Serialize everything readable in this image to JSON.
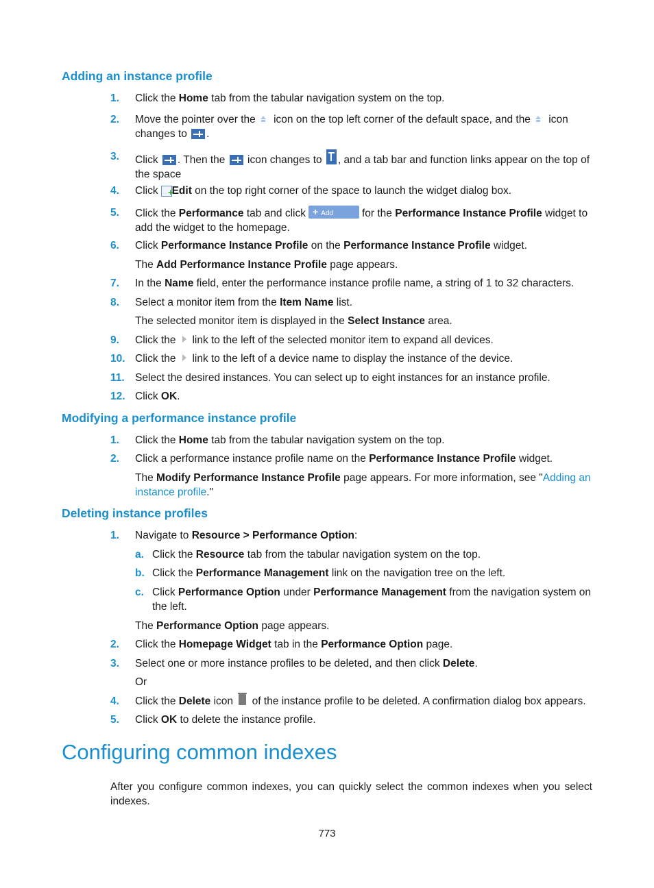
{
  "sections": {
    "adding": {
      "title": "Adding an instance profile",
      "steps": [
        {
          "num": "1.",
          "parts": [
            "Click the ",
            "Home",
            " tab from the tabular navigation system on the top."
          ]
        },
        {
          "num": "2.",
          "a": "Move the pointer over the",
          "b": "icon on the top left corner of the default space, and the",
          "c": "icon",
          "d": "changes to",
          "e": "."
        },
        {
          "num": "3.",
          "a": "Click",
          "b": ". Then the",
          "c": "icon changes to",
          "d": ", and a tab bar and function links appear on the top of the space"
        },
        {
          "num": "4.",
          "a": "Click",
          "b": "Edit",
          "c": " on the top right corner of the space to launch the widget dialog box."
        },
        {
          "num": "5.",
          "a": "Click the ",
          "b": "Performance",
          "c": " tab and click",
          "d": "for the ",
          "e": "Performance Instance Profile",
          "f": " widget to add the widget to the homepage."
        },
        {
          "num": "6.",
          "a": "Click ",
          "b": "Performance Instance Profile",
          "c": " on the ",
          "d": "Performance Instance Profile",
          "e": " widget."
        },
        {
          "num": "7.",
          "a": "In the ",
          "b": "Name",
          "c": " field, enter the performance instance profile name, a string of 1 to 32 characters."
        },
        {
          "num": "8.",
          "a": "Select a monitor item from the ",
          "b": "Item Name",
          "c": " list."
        },
        {
          "num": "9.",
          "a": "Click the",
          "b": "link to the left of the selected monitor item to expand all devices."
        },
        {
          "num": "10.",
          "a": "Click the",
          "b": "link to the left of a device name to display the instance of the device."
        },
        {
          "num": "11.",
          "a": "Select the desired instances. You can select up to eight instances for an instance profile."
        },
        {
          "num": "12.",
          "a": "Click ",
          "b": "OK",
          "c": "."
        }
      ],
      "note6": {
        "a": "The ",
        "b": "Add Performance Instance Profile",
        "c": " page appears."
      },
      "note8": {
        "a": "The selected monitor item is displayed in the ",
        "b": "Select Instance",
        "c": " area."
      },
      "add_button_label": "Add"
    },
    "modifying": {
      "title": "Modifying a performance instance profile",
      "steps": [
        {
          "num": "1.",
          "a": "Click the ",
          "b": "Home",
          "c": " tab from the tabular navigation system on the top."
        },
        {
          "num": "2.",
          "a": "Click a performance instance profile name on the ",
          "b": "Performance Instance Profile",
          "c": " widget."
        }
      ],
      "note2": {
        "a": "The ",
        "b": "Modify Performance Instance Profile",
        "c": " page appears. For more information, see \"",
        "link": "Adding an instance profile",
        "d": ".\""
      }
    },
    "deleting": {
      "title": "Deleting instance profiles",
      "steps": [
        {
          "num": "1.",
          "a": "Navigate to ",
          "b": "Resource > Performance Option",
          "c": ":"
        },
        {
          "num": "2.",
          "a": "Click the ",
          "b": "Homepage Widget",
          "c": " tab in the ",
          "d": "Performance Option",
          "e": " page."
        },
        {
          "num": "3.",
          "a": "Select one or more instance profiles to be deleted, and then click ",
          "b": "Delete",
          "c": "."
        },
        {
          "num": "4.",
          "a": "Click the ",
          "b": "Delete",
          "c": " icon",
          "d": "of the instance profile to be deleted. A confirmation dialog box appears."
        },
        {
          "num": "5.",
          "a": "Click ",
          "b": "OK",
          "c": " to delete the instance profile."
        }
      ],
      "substeps": [
        {
          "num": "a.",
          "a": "Click the ",
          "b": "Resource",
          "c": " tab from the tabular navigation system on the top."
        },
        {
          "num": "b.",
          "a": "Click the ",
          "b": "Performance Management",
          "c": " link on the navigation tree on the left."
        },
        {
          "num": "c.",
          "a": "Click ",
          "b": "Performance Option",
          "c": " under ",
          "d": "Performance Management",
          "e": " from the navigation system on the left."
        }
      ],
      "note1": {
        "a": "The ",
        "b": "Performance Option",
        "c": " page appears."
      },
      "or": "Or"
    },
    "common": {
      "title": "Configuring common indexes",
      "paragraph": "After you configure common indexes, you can quickly select the common indexes when you select indexes."
    }
  },
  "page_number": "773"
}
